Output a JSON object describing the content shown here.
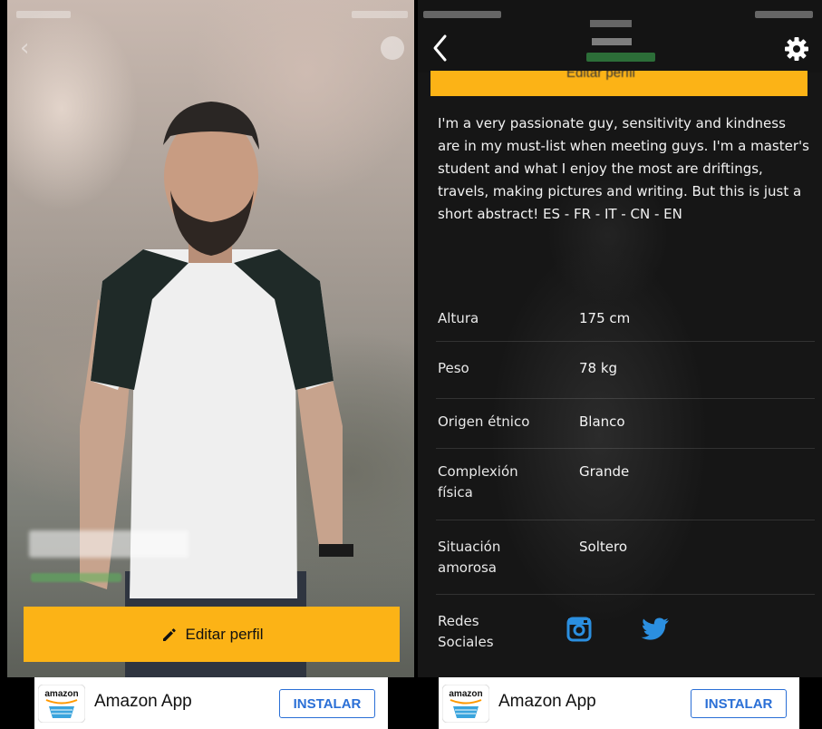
{
  "left_screen": {
    "edit_button_label": "Editar perfil"
  },
  "right_screen": {
    "about_text": "I'm a very passionate guy, sensitivity and kindness are in my must-list when meeting guys. I'm a master's student and what I enjoy the most are driftings, travels, making pictures and writing. But this is just a short abstract! ES - FR - IT - CN - EN",
    "details": [
      {
        "label": "Altura",
        "value": "175 cm"
      },
      {
        "label": "Peso",
        "value": "78 kg"
      },
      {
        "label": "Origen étnico",
        "value": "Blanco"
      },
      {
        "label": "Complexión física",
        "value": "Grande"
      },
      {
        "label": "Situación amorosa",
        "value": "Soltero"
      }
    ],
    "social_label": "Redes Sociales",
    "social_icons": [
      "instagram-icon",
      "twitter-icon"
    ]
  },
  "ads": [
    {
      "app_name": "Amazon App",
      "install_label": "INSTALAR",
      "logo_text": "amazon"
    },
    {
      "app_name": "Amazon App",
      "install_label": "INSTALAR",
      "logo_text": "amazon"
    }
  ],
  "colors": {
    "accent_yellow": "#fcb316",
    "install_blue": "#2a6fd6",
    "dark_bg": "#161616"
  }
}
